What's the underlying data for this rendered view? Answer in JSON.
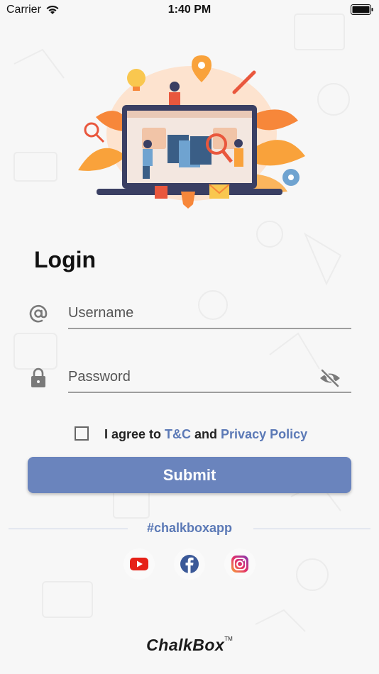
{
  "status_bar": {
    "carrier": "Carrier",
    "time": "1:40 PM",
    "icons": [
      "wifi-icon",
      "battery-icon"
    ]
  },
  "login": {
    "title": "Login",
    "username": {
      "placeholder": "Username",
      "icon": "at-icon"
    },
    "password": {
      "placeholder": "Password",
      "icon": "lock-icon",
      "toggle_icon": "eye-slash-icon"
    },
    "agree": {
      "prefix": "I agree to ",
      "terms": "T&C",
      "middle": " and ",
      "privacy": "Privacy Policy",
      "checked": false
    },
    "submit_label": "Submit"
  },
  "social": {
    "hashtag": "#chalkboxapp",
    "icons": [
      "youtube-icon",
      "facebook-icon",
      "instagram-icon"
    ]
  },
  "brand": {
    "name": "ChalkBox",
    "tm": "TM"
  },
  "colors": {
    "accent": "#6a84bd",
    "link": "#5b79b6",
    "background": "#f7f7f7",
    "youtube": "#e62117",
    "facebook": "#3b5998",
    "hero_orange": "#f9a23b"
  }
}
